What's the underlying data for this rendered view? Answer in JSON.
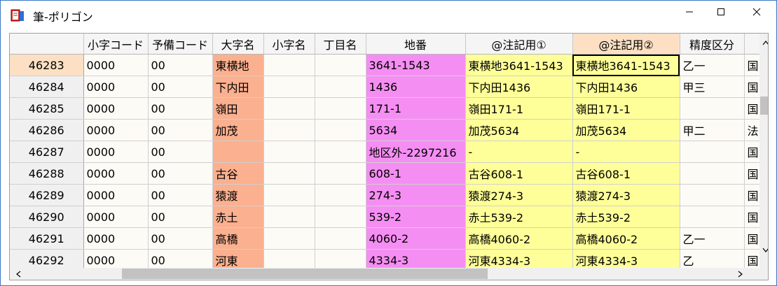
{
  "window": {
    "title": "筆-ポリゴン",
    "icon": "book-icon",
    "controls": [
      "minimize-icon",
      "maximize-icon",
      "close-icon"
    ]
  },
  "grid": {
    "columns": [
      "小字コード",
      "予備コード",
      "大字名",
      "小字名",
      "丁目名",
      "地番",
      "@注記用①",
      "@注記用②",
      "精度区分"
    ],
    "selected_column": "@注記用②",
    "current_row": "46283",
    "rows": [
      {
        "id": "46283",
        "cells": [
          "0000",
          "00",
          "東横地",
          "",
          "",
          "3641-1543",
          "東横地3641-1543",
          "東横地3641-1543",
          "乙一",
          "国"
        ]
      },
      {
        "id": "46284",
        "cells": [
          "0000",
          "00",
          "下内田",
          "",
          "",
          "1436",
          "下内田1436",
          "下内田1436",
          "甲三",
          "国"
        ]
      },
      {
        "id": "46285",
        "cells": [
          "0000",
          "00",
          "嶺田",
          "",
          "",
          "171-1",
          "嶺田171-1",
          "嶺田171-1",
          "",
          "国"
        ]
      },
      {
        "id": "46286",
        "cells": [
          "0000",
          "00",
          "加茂",
          "",
          "",
          "5634",
          "加茂5634",
          "加茂5634",
          "甲二",
          "法"
        ]
      },
      {
        "id": "46287",
        "cells": [
          "0000",
          "00",
          "",
          "",
          "",
          "地区外-2297216",
          "-",
          "-",
          "",
          "国"
        ]
      },
      {
        "id": "46288",
        "cells": [
          "0000",
          "00",
          "古谷",
          "",
          "",
          "608-1",
          "古谷608-1",
          "古谷608-1",
          "",
          "国"
        ]
      },
      {
        "id": "46289",
        "cells": [
          "0000",
          "00",
          "猿渡",
          "",
          "",
          "274-3",
          "猿渡274-3",
          "猿渡274-3",
          "",
          "国"
        ]
      },
      {
        "id": "46290",
        "cells": [
          "0000",
          "00",
          "赤土",
          "",
          "",
          "539-2",
          "赤土539-2",
          "赤土539-2",
          "",
          "国"
        ]
      },
      {
        "id": "46291",
        "cells": [
          "0000",
          "00",
          "高橋",
          "",
          "",
          "4060-2",
          "高橋4060-2",
          "高橋4060-2",
          "乙一",
          "国"
        ]
      },
      {
        "id": "46292",
        "cells": [
          "0000",
          "00",
          "河東",
          "",
          "",
          "4334-3",
          "河東4334-3",
          "河東4334-3",
          "乙",
          "国"
        ]
      }
    ]
  },
  "colors": {
    "oaza": "#fbb08f",
    "chiban": "#f58ef2",
    "chuki": "#ffff99",
    "selected_header": "#fde0c4"
  }
}
